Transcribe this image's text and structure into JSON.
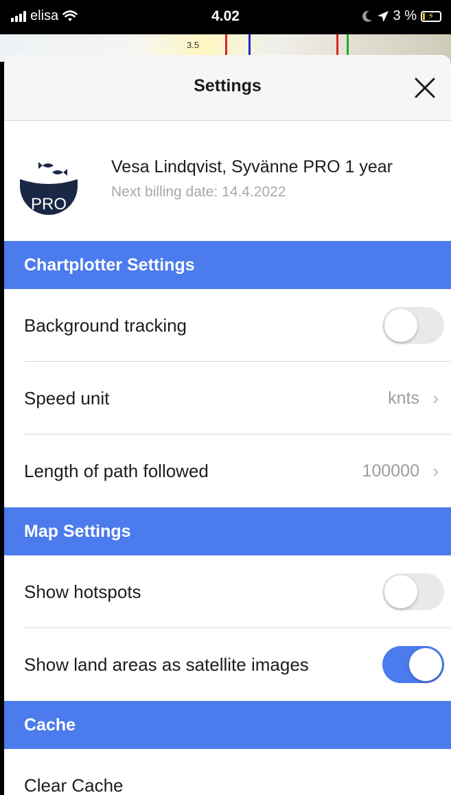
{
  "status_bar": {
    "carrier": "elisa",
    "time": "4.02",
    "battery_text": "3 %"
  },
  "map_peek": {
    "depth_label": "3.5"
  },
  "header": {
    "title": "Settings",
    "close_icon": "close-icon"
  },
  "profile": {
    "logo_text": "PRO",
    "name": "Vesa Lindqvist, Syvänne PRO 1 year",
    "billing": "Next billing date: 14.4.2022"
  },
  "sections": {
    "chartplotter": {
      "title": "Chartplotter Settings",
      "background_tracking": {
        "label": "Background tracking",
        "enabled": false
      },
      "speed_unit": {
        "label": "Speed unit",
        "value": "knts"
      },
      "path_length": {
        "label": "Length of path followed",
        "value": "100000"
      }
    },
    "map": {
      "title": "Map Settings",
      "show_hotspots": {
        "label": "Show hotspots",
        "enabled": false
      },
      "satellite_land": {
        "label": "Show land areas as satellite images",
        "enabled": true
      }
    },
    "cache": {
      "title": "Cache",
      "clear_cache": {
        "label": "Clear Cache"
      }
    }
  },
  "chevron": "›",
  "colors": {
    "accent": "#4b7bec",
    "toggle_off": "#e9e9ea",
    "logo_navy": "#1a2745"
  }
}
